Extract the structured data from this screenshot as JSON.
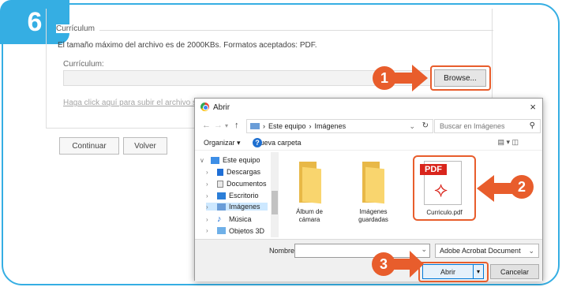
{
  "step_number": "6",
  "form": {
    "legend": "Currículum",
    "help_text": "El tamaño máximo del archivo es de 2000KBs. Formatos aceptados: PDF.",
    "cv_label": "Currículum:",
    "browse_label": "Browse...",
    "upload_link": "Haga click aquí para subir el archivo seleccionado",
    "continue_label": "Continuar",
    "back_label": "Volver"
  },
  "callouts": [
    "1",
    "2",
    "3"
  ],
  "dialog": {
    "title": "Abrir",
    "close": "×",
    "breadcrumb": [
      "Este equipo",
      "Imágenes"
    ],
    "search_placeholder": "Buscar en Imágenes",
    "toolbar": {
      "organize": "Organizar ▾",
      "new_folder": "Nueva carpeta",
      "help": "?"
    },
    "tree": [
      {
        "label": "Este equipo",
        "icon": "computer-icon"
      },
      {
        "label": "Descargas",
        "icon": "download-icon"
      },
      {
        "label": "Documentos",
        "icon": "documents-icon"
      },
      {
        "label": "Escritorio",
        "icon": "desktop-icon"
      },
      {
        "label": "Imágenes",
        "icon": "pictures-icon",
        "selected": true
      },
      {
        "label": "Música",
        "icon": "music-icon"
      },
      {
        "label": "Objetos 3D",
        "icon": "objects-3d-icon"
      }
    ],
    "files": [
      {
        "name": "Álbum de cámara",
        "line1": "Álbum de",
        "line2": "cámara",
        "type": "folder"
      },
      {
        "name": "Imágenes guardadas",
        "line1": "Imágenes",
        "line2": "guardadas",
        "type": "folder"
      },
      {
        "name": "Curriculo.pdf",
        "type": "pdf",
        "tag": "PDF"
      }
    ],
    "filename_label": "Nombre:",
    "filename_value": "",
    "file_type": "Adobe Acrobat Document",
    "open_label": "Abrir",
    "cancel_label": "Cancelar"
  },
  "colors": {
    "frame": "#35aee3",
    "accent": "#e85d2c",
    "pdf_red": "#d9251c"
  }
}
